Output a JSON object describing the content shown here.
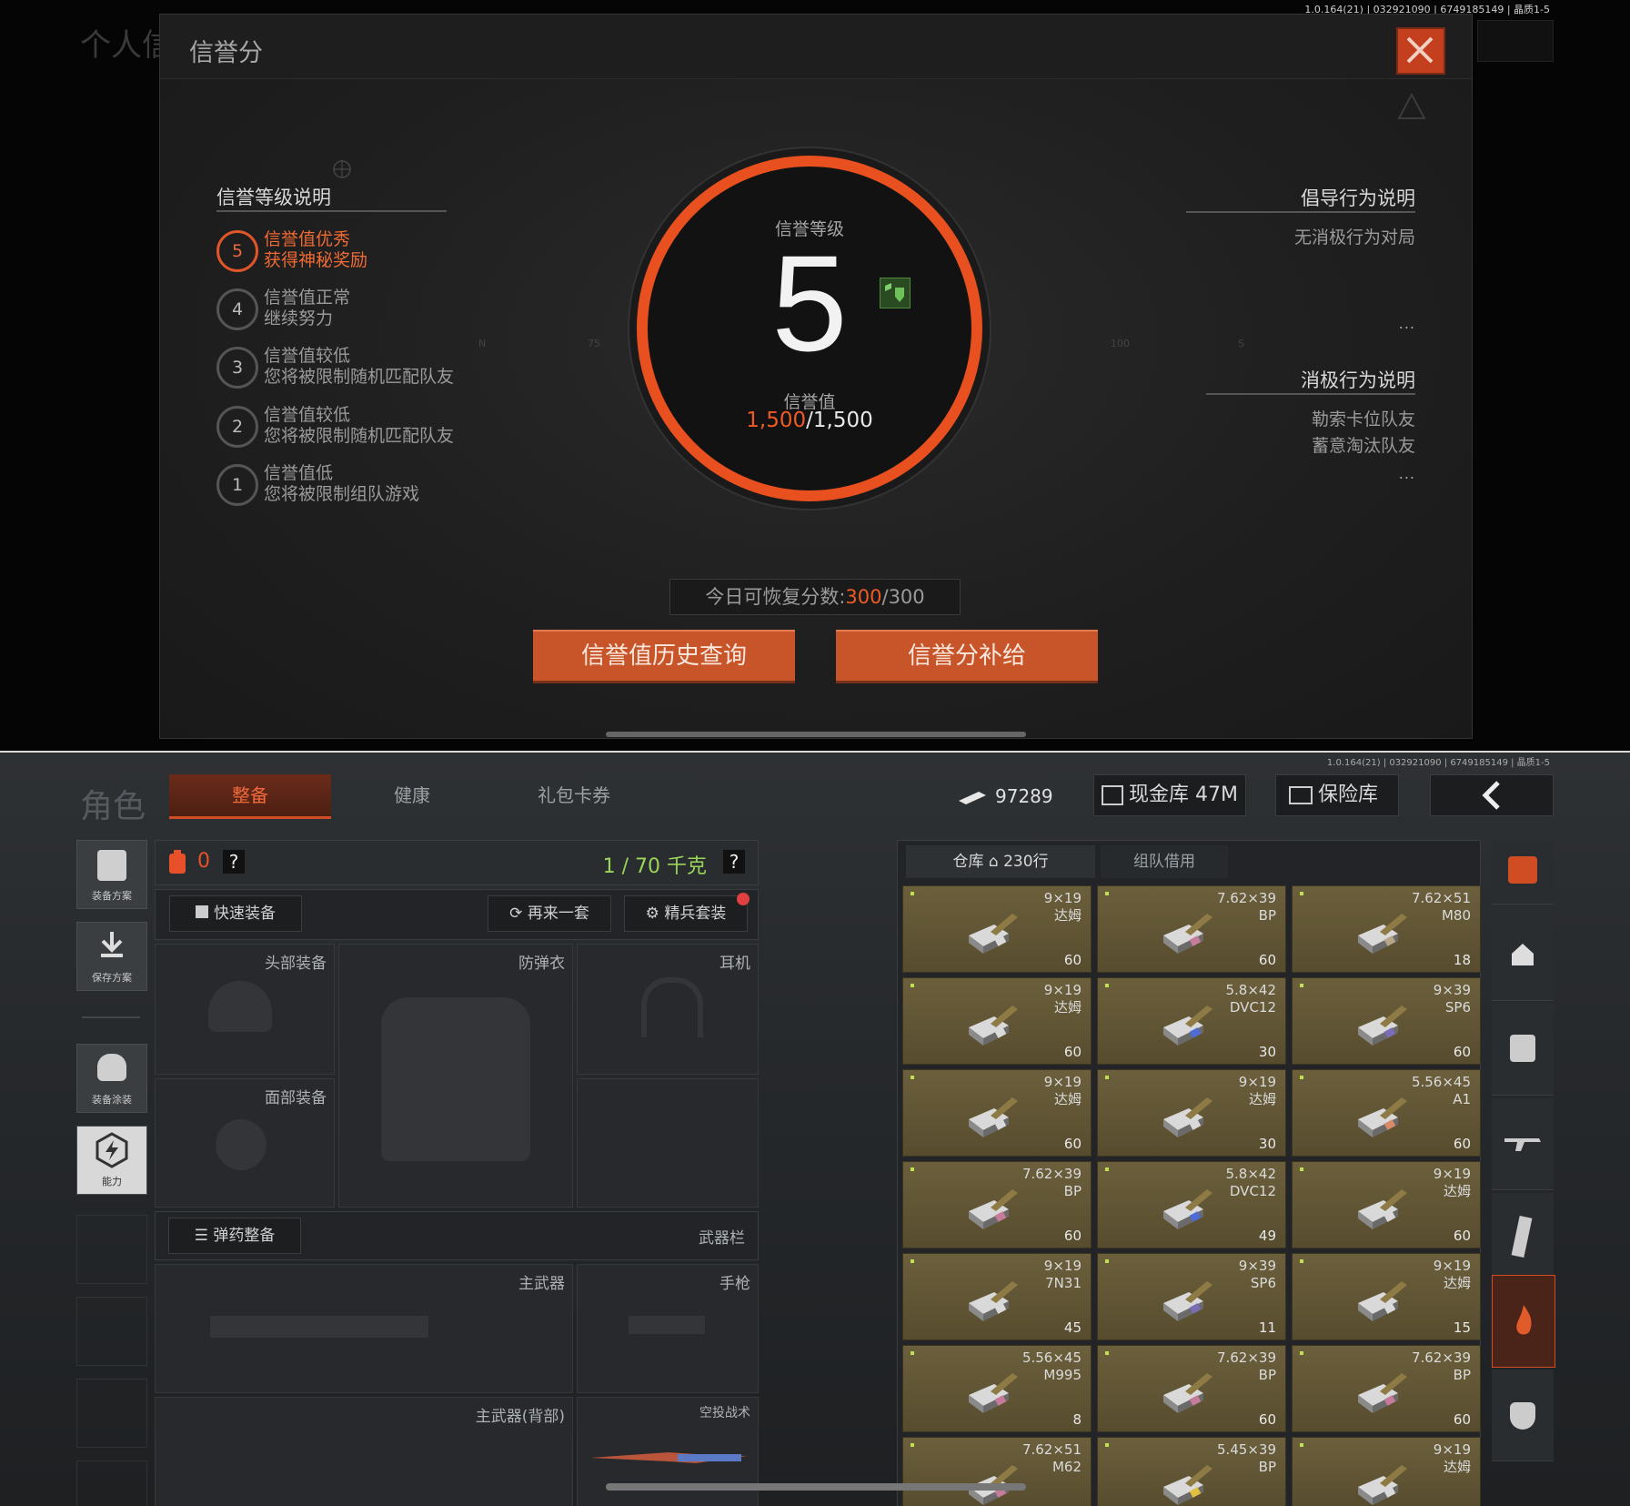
{
  "top": {
    "version": "1.0.164(21) | 032921090 | 6749185149 | 晶质1-5",
    "bg_title": "个人信",
    "modal": {
      "title": "信誉分",
      "close_icon": "close-icon",
      "left_section": {
        "title": "信誉等级说明",
        "levels": [
          {
            "num": "5",
            "line1": "信誉值优秀",
            "line2": "获得神秘奖励",
            "active": true
          },
          {
            "num": "4",
            "line1": "信誉值正常",
            "line2": "继续努力",
            "active": false
          },
          {
            "num": "3",
            "line1": "信誉值较低",
            "line2": "您将被限制随机匹配队友",
            "active": false
          },
          {
            "num": "2",
            "line1": "信誉值较低",
            "line2": "您将被限制随机匹配队友",
            "active": false
          },
          {
            "num": "1",
            "line1": "信誉值低",
            "line2": "您将被限制组队游戏",
            "active": false
          }
        ]
      },
      "center": {
        "level_label": "信誉等级",
        "level": "5",
        "score_label": "信誉值",
        "score_current": "1,500",
        "score_max": "/1,500"
      },
      "right_section": {
        "positive_title": "倡导行为说明",
        "positive_items": [
          "无消极行为对局"
        ],
        "positive_more": "...",
        "negative_title": "消极行为说明",
        "negative_items": [
          "勒索卡位队友",
          "蓄意淘汰队友"
        ],
        "negative_more": "..."
      },
      "today_prefix": "今日可恢复分数:",
      "today_value": "300",
      "today_max": "/300",
      "buttons": {
        "history": "信誉值历史查询",
        "supply": "信誉分补给"
      },
      "accent": "#e8501f"
    }
  },
  "bottom": {
    "version": "1.0.164(21) | 032921090 | 6749185149 | 晶质1-5",
    "title": "角色",
    "tabs": [
      {
        "label": "整备",
        "active": true
      },
      {
        "label": "健康",
        "active": false
      },
      {
        "label": "礼包卡券",
        "active": false
      }
    ],
    "currency": "97289",
    "cash_vault": "现金库 47M",
    "safe": "保险库",
    "side_buttons": [
      "装备方案",
      "保存方案",
      "装备涂装",
      "能力"
    ],
    "loadout": {
      "backpack_count": "0",
      "weight": "1 / 70 千克",
      "help": "?",
      "quick_equip": "快速装备",
      "again": "再来一套",
      "elite": "精兵套装",
      "slots": {
        "head": "头部装备",
        "armor": "防弹衣",
        "ear": "耳机",
        "face": "面部装备",
        "ammo_prep": "弹药整备",
        "weapon_bar": "武器栏",
        "primary": "主武器",
        "pistol": "手枪",
        "primary_back": "主武器(背部)",
        "melee": "空投战术"
      }
    },
    "warehouse": {
      "tab_storage": "仓库",
      "storage_count": "230行",
      "tab_team": "组队借用",
      "items": [
        {
          "cal": "9×19",
          "type": "达姆",
          "count": "60",
          "accent": "#d9d9d9"
        },
        {
          "cal": "7.62×39",
          "type": "BP",
          "count": "60",
          "accent": "#c77b9a"
        },
        {
          "cal": "7.62×51",
          "type": "M80",
          "count": "18",
          "accent": "#b7a58a"
        },
        {
          "cal": "9×19",
          "type": "达姆",
          "count": "60",
          "accent": "#d9d9d9"
        },
        {
          "cal": "5.8×42",
          "type": "DVC12",
          "count": "30",
          "accent": "#4f6bd6"
        },
        {
          "cal": "9×39",
          "type": "SP6",
          "count": "60",
          "accent": "#7a6db6"
        },
        {
          "cal": "9×19",
          "type": "达姆",
          "count": "60",
          "accent": "#d9d9d9"
        },
        {
          "cal": "9×19",
          "type": "达姆",
          "count": "30",
          "accent": "#d9d9d9"
        },
        {
          "cal": "5.56×45",
          "type": "A1",
          "count": "60",
          "accent": "#d98a6a"
        },
        {
          "cal": "7.62×39",
          "type": "BP",
          "count": "60",
          "accent": "#c77b9a"
        },
        {
          "cal": "5.8×42",
          "type": "DVC12",
          "count": "49",
          "accent": "#4f6bd6"
        },
        {
          "cal": "9×19",
          "type": "达姆",
          "count": "60",
          "accent": "#d9d9d9"
        },
        {
          "cal": "9×19",
          "type": "7N31",
          "count": "45",
          "accent": "#d9d9d9"
        },
        {
          "cal": "9×39",
          "type": "SP6",
          "count": "11",
          "accent": "#7a6db6"
        },
        {
          "cal": "9×19",
          "type": "达姆",
          "count": "15",
          "accent": "#d9d9d9"
        },
        {
          "cal": "5.56×45",
          "type": "M995",
          "count": "8",
          "accent": "#c77b9a"
        },
        {
          "cal": "7.62×39",
          "type": "BP",
          "count": "60",
          "accent": "#c77b9a"
        },
        {
          "cal": "7.62×39",
          "type": "BP",
          "count": "60",
          "accent": "#c77b9a"
        },
        {
          "cal": "7.62×51",
          "type": "M62",
          "count": "",
          "accent": "#c77b9a"
        },
        {
          "cal": "5.45×39",
          "type": "BP",
          "count": "",
          "accent": "#e0c040"
        },
        {
          "cal": "9×19",
          "type": "达姆",
          "count": "",
          "accent": "#d9d9d9"
        }
      ]
    },
    "right_tabs": [
      "ammo-crate-icon",
      "home-icon",
      "backpack-icon",
      "rifle-icon",
      "magazine-icon",
      "fire-icon",
      "armor-icon"
    ]
  }
}
